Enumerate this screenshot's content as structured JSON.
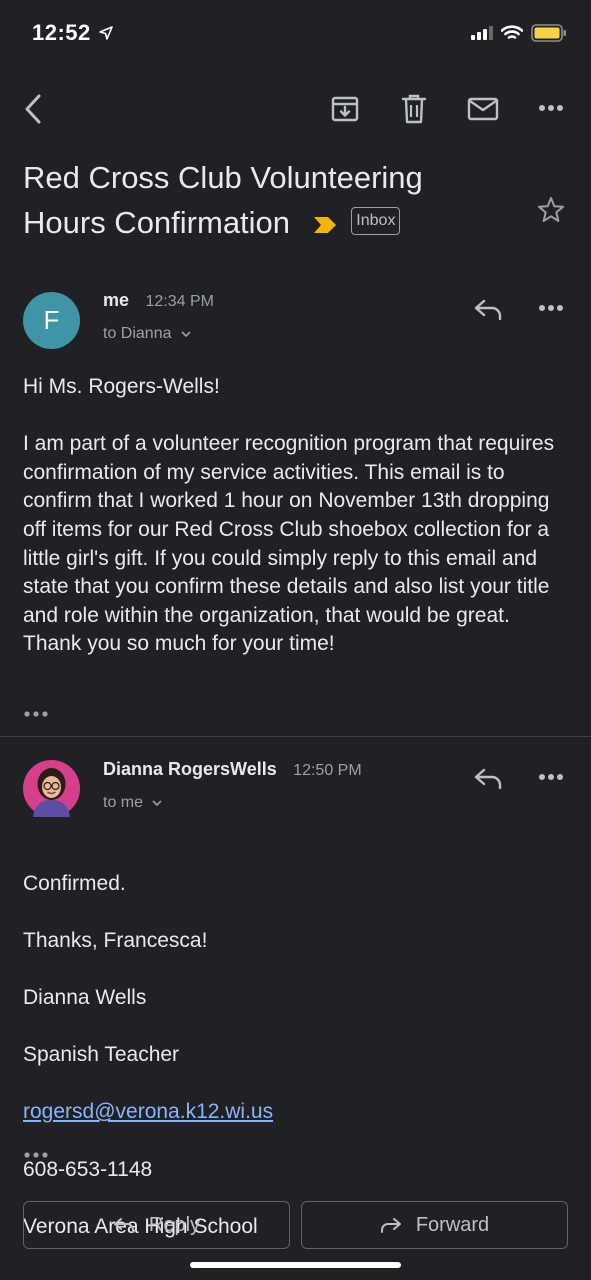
{
  "status": {
    "time": "12:52"
  },
  "email": {
    "subject": "Red Cross Club Volunteering Hours Confirmation",
    "label": "Inbox"
  },
  "messages": [
    {
      "avatar_letter": "F",
      "sender": "me",
      "time": "12:34 PM",
      "to": "to Dianna",
      "body": "Hi Ms. Rogers-Wells!\n\nI am part of a volunteer recognition program that requires confirmation of my service activities. This email is to confirm that I worked 1 hour on November 13th dropping off items for our Red Cross Club shoebox collection for a little girl's gift. If you could simply reply to this email and state that you confirm these details and also list your title and role within the organization, that would be great. Thank you so much for your time!"
    },
    {
      "sender": "Dianna RogersWells",
      "time": "12:50 PM",
      "to": "to me",
      "lines": [
        "Confirmed.",
        "Thanks, Francesca!",
        "Dianna Wells",
        "Spanish Teacher"
      ],
      "email_link": "rogersd@verona.k12.wi.us",
      "lines_after": [
        "608-653-1148",
        "Verona Area High School"
      ]
    }
  ],
  "actions": {
    "reply": "Reply",
    "forward": "Forward"
  },
  "colors": {
    "accent_link": "#8ab4f8",
    "important_marker": "#f4b400",
    "avatar_f": "#3f95a5"
  }
}
